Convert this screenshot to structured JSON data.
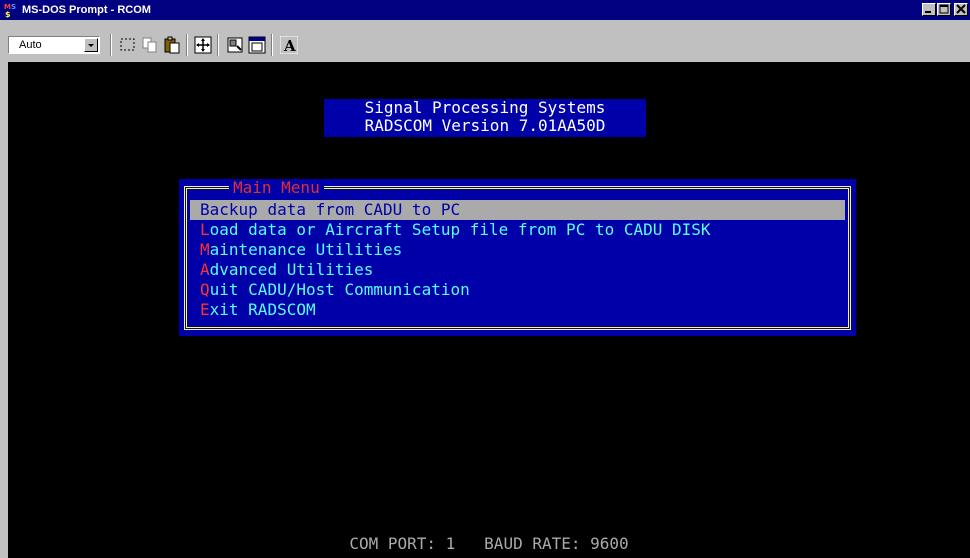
{
  "window": {
    "title": "MS-DOS Prompt - RCOM",
    "controls": [
      "minimize",
      "maximize",
      "close"
    ]
  },
  "toolbar": {
    "font_size_value": "Auto",
    "buttons": [
      {
        "name": "mark-icon"
      },
      {
        "name": "copy-icon"
      },
      {
        "name": "paste-icon"
      },
      {
        "name": "full-screen-icon"
      },
      {
        "name": "properties-icon"
      },
      {
        "name": "background-icon"
      },
      {
        "name": "font-icon"
      }
    ]
  },
  "screen": {
    "header_line1": "Signal Processing Systems",
    "header_line2": "RADSCOM Version 7.01AA50D",
    "menu_title": "Main Menu",
    "menu_items": [
      {
        "hot": "B",
        "rest": "ackup data from CADU to PC",
        "selected": true
      },
      {
        "hot": "L",
        "rest": "oad data or Aircraft Setup file from PC to CADU DISK",
        "selected": false
      },
      {
        "hot": "M",
        "rest": "aintenance Utilities",
        "selected": false
      },
      {
        "hot": "A",
        "rest": "dvanced Utilities",
        "selected": false
      },
      {
        "hot": "Q",
        "rest": "uit CADU/Host Communication",
        "selected": false
      },
      {
        "hot": "E",
        "rest": "xit RADSCOM",
        "selected": false,
        "hot_prefix": "",
        "hot_index": 1
      }
    ],
    "status_line": "COM PORT: 1   BAUD RATE: 9600"
  },
  "colors": {
    "titlebar": "#000080",
    "dos_blue": "#0000a8",
    "menu_text": "#55ffff",
    "hotkey": "#ff3030",
    "frame": "#ffff55",
    "highlight": "#aaaaaa"
  }
}
